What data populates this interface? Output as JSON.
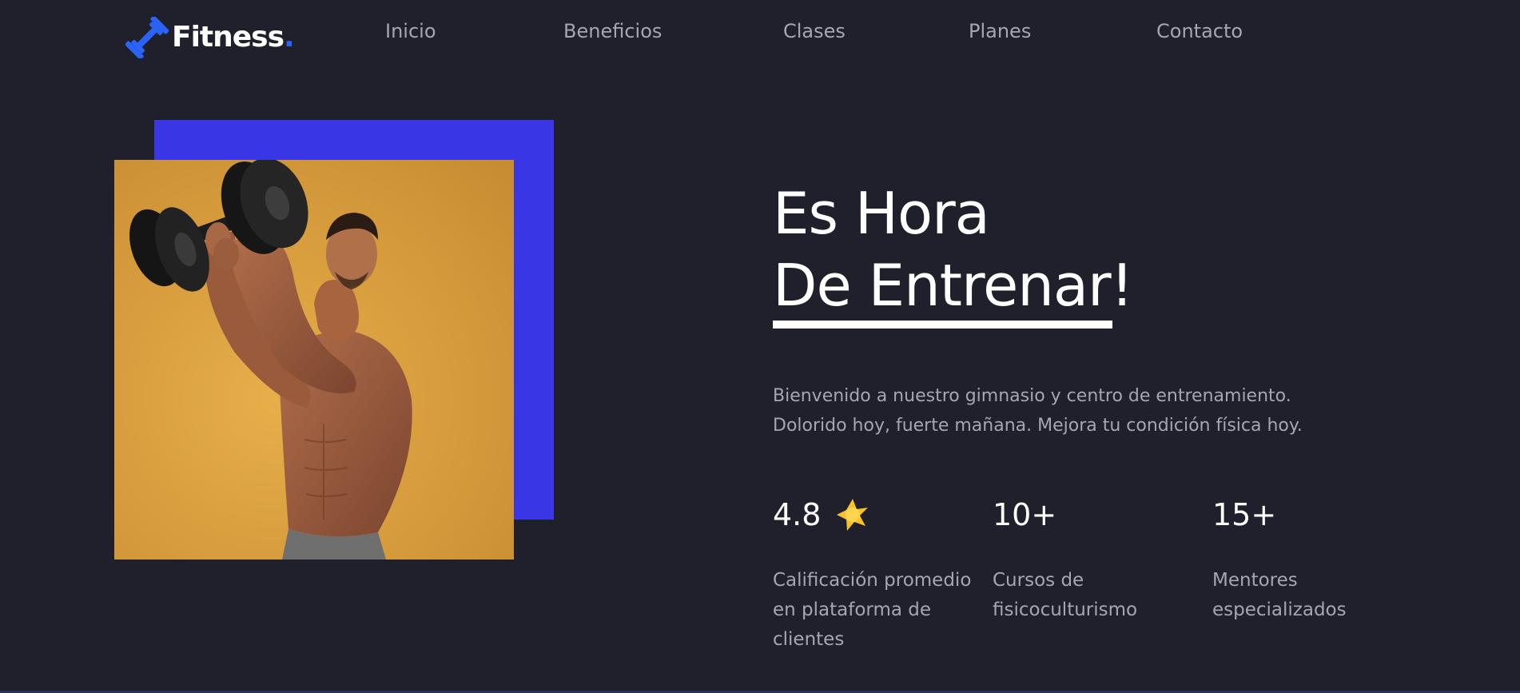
{
  "header": {
    "logo": {
      "text": "Fitness",
      "dot": ".",
      "icon": "dumbbell-logo-icon",
      "accent_color": "#2a63f5"
    },
    "nav": [
      {
        "label": "Inicio"
      },
      {
        "label": "Beneficios"
      },
      {
        "label": "Clases"
      },
      {
        "label": "Planes"
      },
      {
        "label": "Contacto"
      }
    ]
  },
  "hero": {
    "title_line1": "Es Hora",
    "title_line2": "De Entrenar!",
    "description_line1": "Bienvenido a nuestro gimnasio y centro de entrenamiento.",
    "description_line2": "Dolorido hoy, fuerte mañana. Mejora tu condición física hoy.",
    "image": "man-lifting-dumbbell-photo",
    "image_background_color": "#dba241",
    "accent_block_color": "#3936e6"
  },
  "stats": [
    {
      "value": "4.8",
      "icon": "star-icon",
      "label_lines": [
        "Calificación promedio",
        "en plataforma de",
        "clientes"
      ]
    },
    {
      "value": "10+",
      "label_lines": [
        "Cursos de",
        "fisicoculturismo"
      ]
    },
    {
      "value": "15+",
      "label_lines": [
        "Mentores",
        "especializados"
      ]
    }
  ],
  "colors": {
    "background": "#1f202c",
    "text_primary": "#ffffff",
    "text_muted": "#a6a6b2",
    "star": "#f6c12a"
  }
}
